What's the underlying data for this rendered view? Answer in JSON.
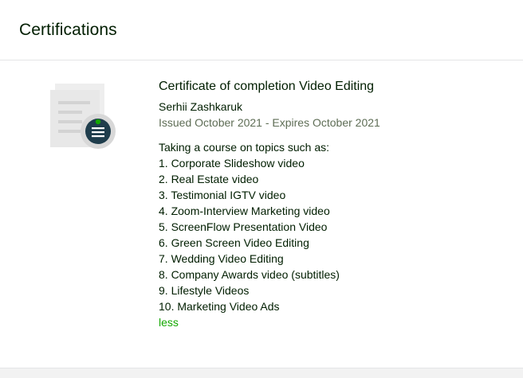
{
  "section": {
    "title": "Certifications"
  },
  "certificate": {
    "icon": "certificate-document-icon",
    "title": "Certificate of completion Video Editing",
    "issuer": "Serhii Zashkaruk",
    "dates": "Issued October 2021 - Expires October 2021",
    "description_intro": "Taking a course on topics such as:",
    "topics": [
      "1. Corporate Slideshow video",
      "2. Real Estate video",
      "3. Testimonial IGTV video",
      "4. Zoom-Interview Marketing video",
      "5. ScreenFlow Presentation Video",
      "6. Green Screen Video Editing",
      "7. Wedding Video Editing",
      "8. Company Awards video (subtitles)",
      "9. Lifestyle Videos",
      "10. Marketing Video Ads"
    ],
    "less_label": "less"
  },
  "colors": {
    "link": "#14a800",
    "text": "#001e00",
    "muted": "#5e6d55",
    "badge": "#1f3d4c"
  }
}
